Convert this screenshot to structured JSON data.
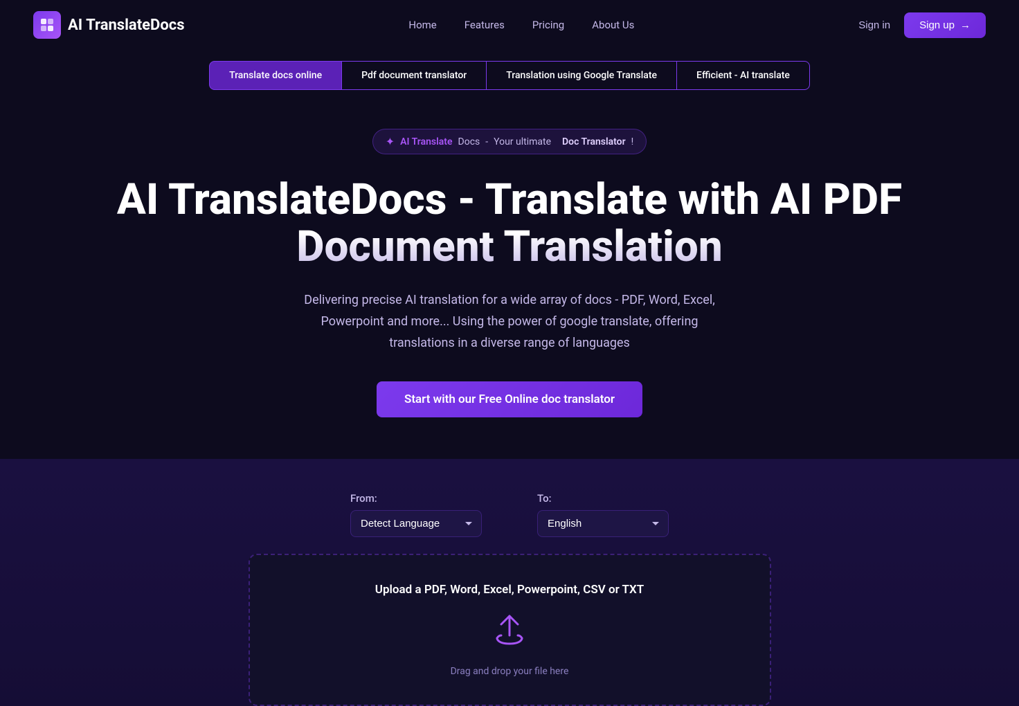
{
  "navbar": {
    "logo_text": "AI TranslateDocs",
    "logo_icon": "✦",
    "links": [
      {
        "label": "Home",
        "id": "home"
      },
      {
        "label": "Features",
        "id": "features"
      },
      {
        "label": "Pricing",
        "id": "pricing"
      },
      {
        "label": "About Us",
        "id": "about"
      }
    ],
    "sign_in_label": "Sign in",
    "sign_up_label": "Sign up",
    "sign_up_arrow": "→"
  },
  "tabs": [
    {
      "label": "Translate docs online",
      "id": "translate-docs"
    },
    {
      "label": "Pdf document translator",
      "id": "pdf-translator"
    },
    {
      "label": "Translation using Google Translate",
      "id": "google-translate"
    },
    {
      "label": "Efficient - AI translate",
      "id": "ai-translate"
    }
  ],
  "hero": {
    "badge": {
      "sparkle": "✦",
      "ai_text": "AI Translate",
      "docs_text": " Docs",
      "separator": " - ",
      "normal_text": "Your ultimate",
      "space": " ",
      "doc_text": "Doc Translator",
      "exclaim": " !"
    },
    "title": "AI TranslateDocs - Translate with AI  PDF Document Translation",
    "description": "Delivering precise AI translation for a wide array of docs - PDF, Word, Excel, Powerpoint and more... Using the power of google translate, offering translations in a diverse range of languages",
    "cta_label": "Start with our Free Online doc translator"
  },
  "translator": {
    "from_label": "From:",
    "to_label": "To:",
    "from_options": [
      {
        "value": "detect",
        "label": "Detect  Language"
      }
    ],
    "to_options": [
      {
        "value": "en",
        "label": "English"
      }
    ],
    "upload_title": "Upload a PDF, Word, Excel, Powerpoint, CSV or TXT",
    "upload_icon": "⬆",
    "drag_drop_text": "Drag and drop your file here"
  },
  "colors": {
    "primary": "#7c3aed",
    "accent": "#a855f7",
    "bg_dark": "#0d0b1e",
    "bg_section": "#1a1040",
    "text_muted": "#c4b8e8"
  }
}
